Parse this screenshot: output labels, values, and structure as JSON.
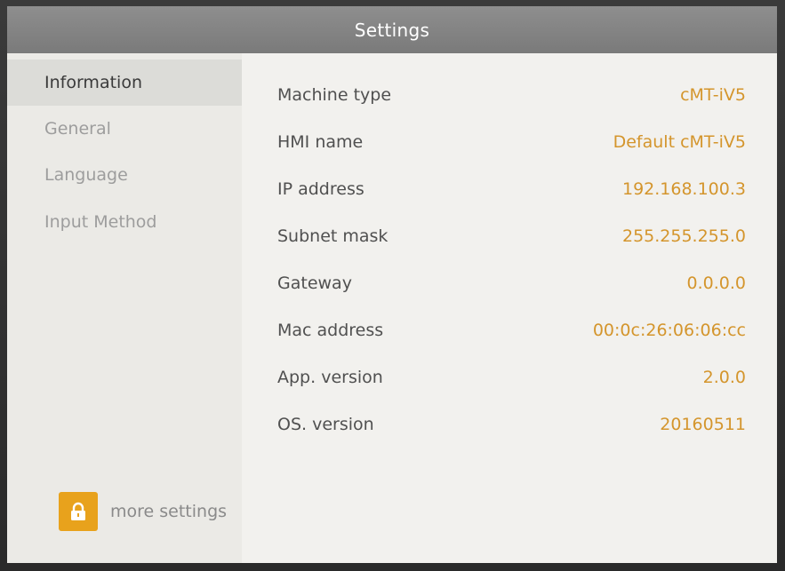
{
  "title": "Settings",
  "sidebar": {
    "items": [
      {
        "label": "Information",
        "active": true
      },
      {
        "label": "General",
        "active": false
      },
      {
        "label": "Language",
        "active": false
      },
      {
        "label": "Input Method",
        "active": false
      }
    ],
    "more_settings_label": "more settings",
    "more_settings_icon": "lock-icon"
  },
  "info": {
    "rows": [
      {
        "label": "Machine type",
        "value": "cMT-iV5"
      },
      {
        "label": "HMI name",
        "value": "Default cMT-iV5"
      },
      {
        "label": "IP address",
        "value": "192.168.100.3"
      },
      {
        "label": "Subnet mask",
        "value": "255.255.255.0"
      },
      {
        "label": "Gateway",
        "value": "0.0.0.0"
      },
      {
        "label": "Mac address",
        "value": "00:0c:26:06:06:cc"
      },
      {
        "label": "App. version",
        "value": "2.0.0"
      },
      {
        "label": "OS. version",
        "value": "20160511"
      }
    ]
  },
  "colors": {
    "title_bar": "#848484",
    "accent_value": "#d4952c",
    "lock_button": "#e8a21c",
    "active_item_bg": "#dcdcd8"
  }
}
